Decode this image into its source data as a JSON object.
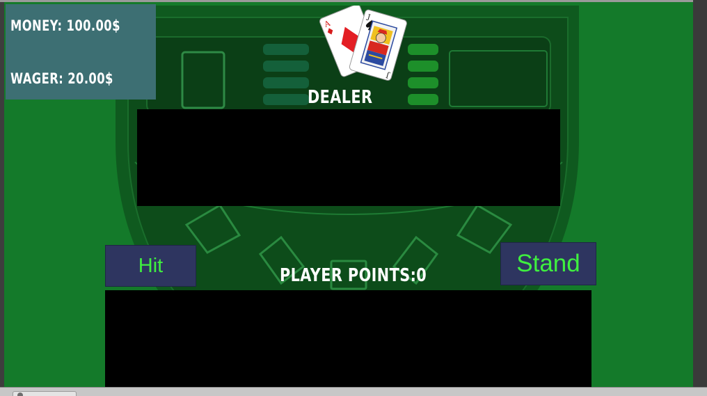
{
  "hud": {
    "money": "MONEY: 100.00$",
    "wager": "WAGER: 20.00$"
  },
  "dealer": {
    "label": "DEALER"
  },
  "player": {
    "points_label": "PLAYER POINTS:0"
  },
  "actions": {
    "hit_label": "Hit",
    "stand_label": "Stand"
  },
  "logo_cards": [
    {
      "rank": "A",
      "suit": "diamonds"
    },
    {
      "rank": "J",
      "suit": "spades"
    }
  ],
  "icons": [
    "ace-of-diamonds-card-icon",
    "jack-of-spades-card-icon"
  ],
  "colors": {
    "felt": "#147a2a",
    "hud_panel": "#3d6f73",
    "button_bg": "#2e3560",
    "button_text": "#3ff03f",
    "card_area": "#000000"
  }
}
